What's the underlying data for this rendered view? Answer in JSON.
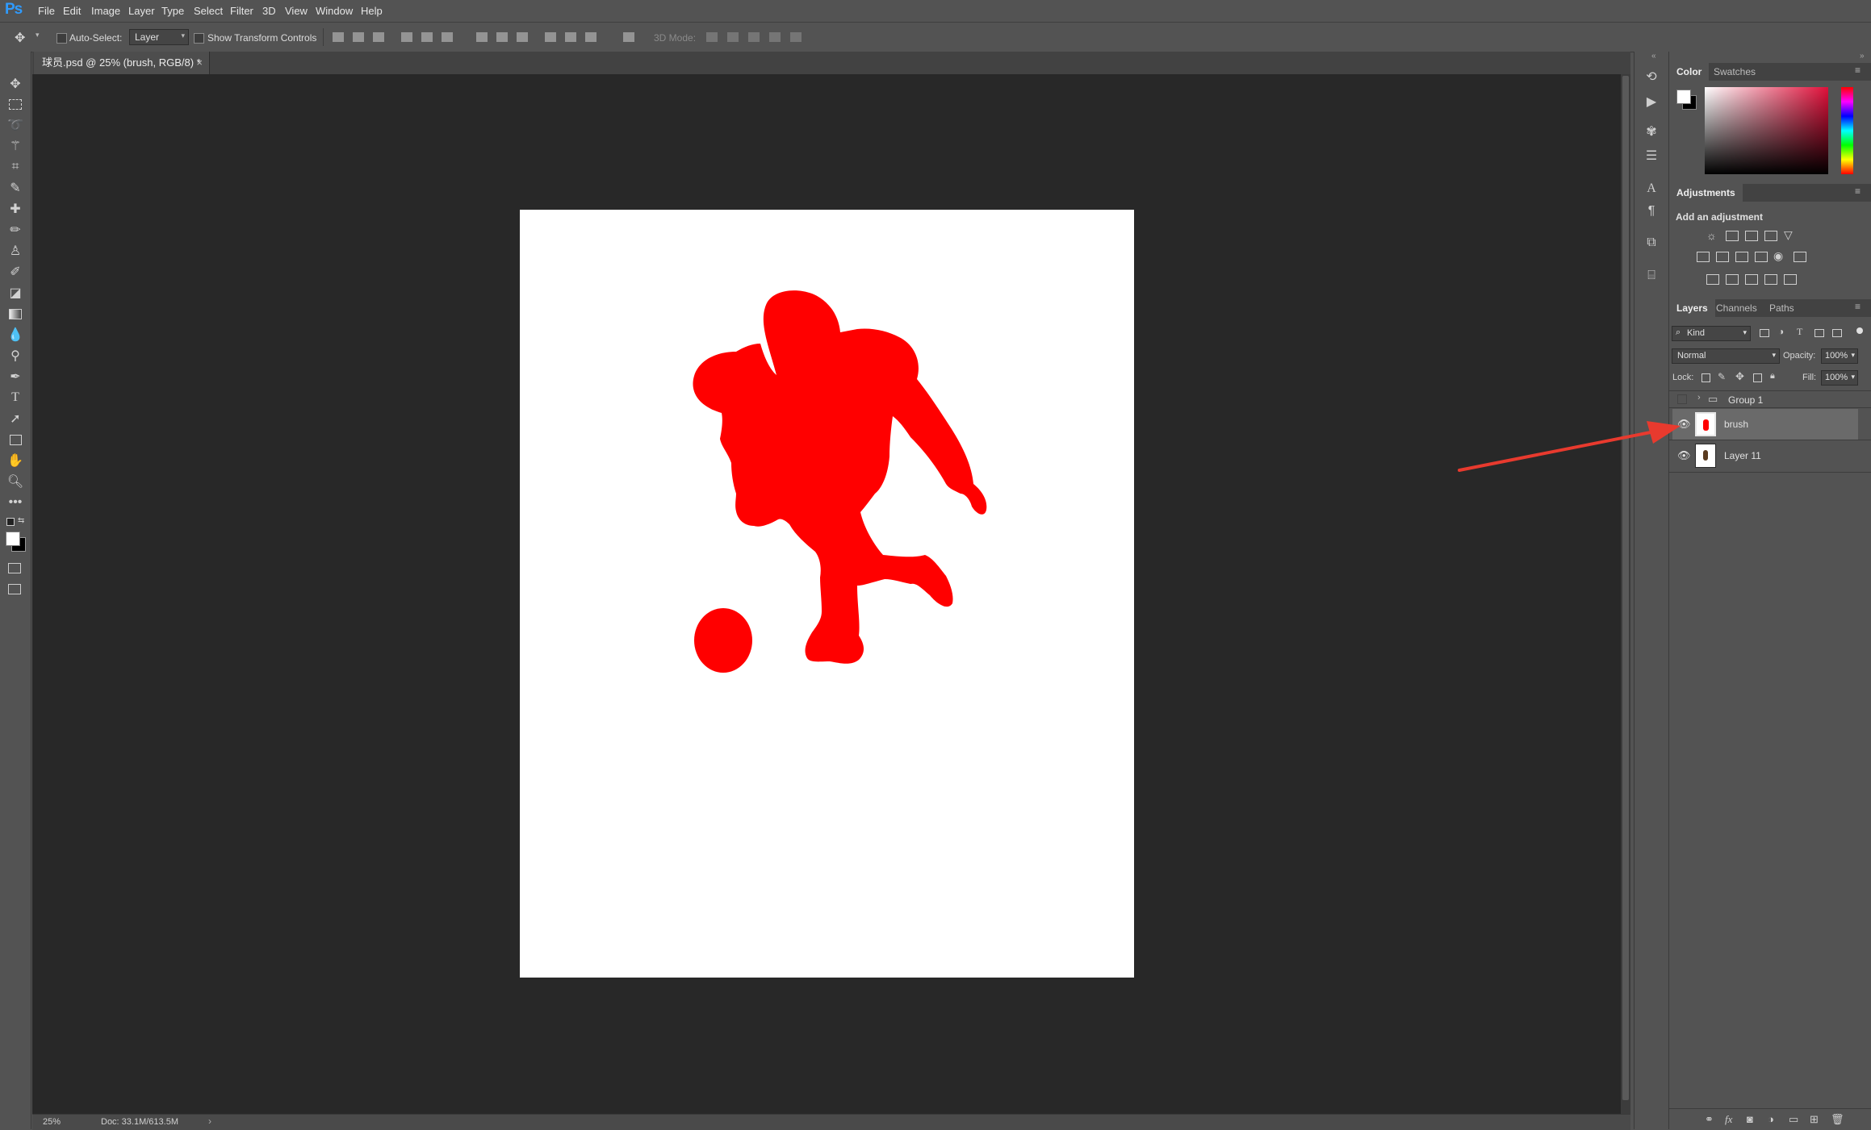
{
  "app": {
    "logo": "Ps",
    "menu": [
      "File",
      "Edit",
      "Image",
      "Layer",
      "Type",
      "Select",
      "Filter",
      "3D",
      "View",
      "Window",
      "Help"
    ]
  },
  "options": {
    "auto_select_label": "Auto-Select:",
    "auto_select_value": "Layer",
    "show_transform_label": "Show Transform Controls",
    "mode_3d_label": "3D Mode:"
  },
  "document": {
    "tab_title": "球员.psd @ 25% (brush, RGB/8) *",
    "close_glyph": "×",
    "fill_color": "#ff0000"
  },
  "status": {
    "zoom": "25%",
    "doc_size": "Doc: 33.1M/613.5M"
  },
  "color_panel": {
    "tabs": [
      "Color",
      "Swatches"
    ],
    "active_tab": "Color"
  },
  "adjustments_panel": {
    "title": "Adjustments",
    "subtitle": "Add an adjustment"
  },
  "layers_panel": {
    "tabs": [
      "Layers",
      "Channels",
      "Paths"
    ],
    "active_tab": "Layers",
    "filter_label": "Kind",
    "blend_mode": "Normal",
    "opacity_label": "Opacity:",
    "opacity_value": "100%",
    "lock_label": "Lock:",
    "fill_label": "Fill:",
    "fill_value": "100%",
    "layers": [
      {
        "name": "Group 1",
        "type": "group",
        "visible": false,
        "selected": false
      },
      {
        "name": "brush",
        "type": "pixel",
        "visible": true,
        "selected": true
      },
      {
        "name": "Layer 11",
        "type": "pixel",
        "visible": true,
        "selected": false
      }
    ]
  },
  "annotation": {
    "arrow_color": "#e83a2e"
  }
}
